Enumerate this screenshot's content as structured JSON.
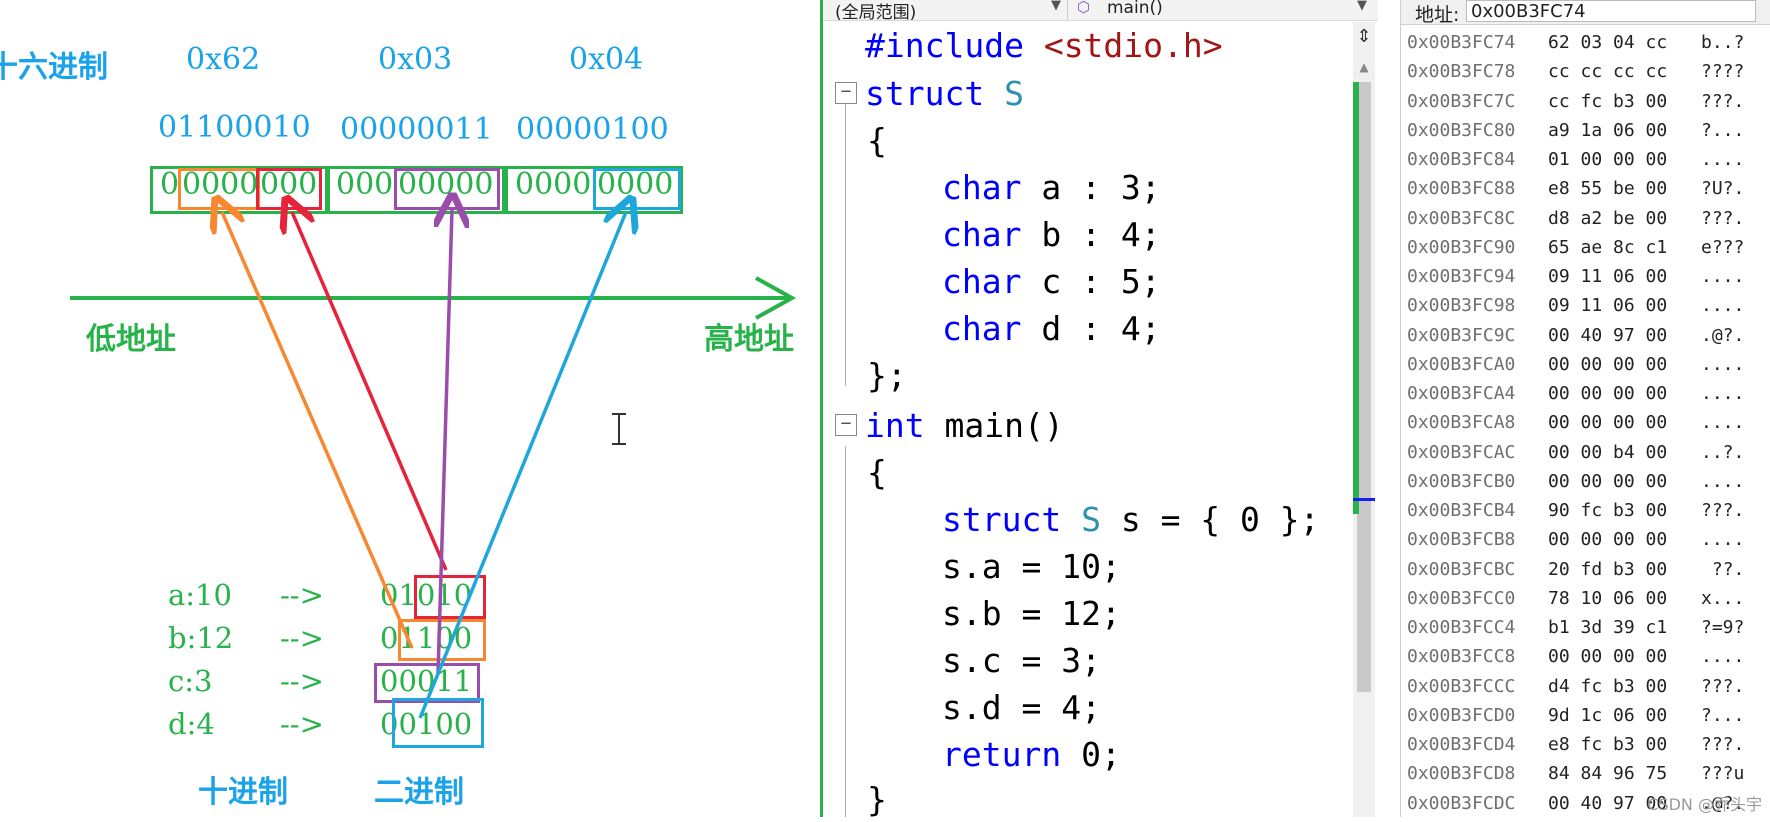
{
  "diagram": {
    "hex_label": "十六进制",
    "hex_values": [
      "0x62",
      "0x03",
      "0x04"
    ],
    "binary_values": [
      "01100010",
      "00000011",
      "00000100"
    ],
    "bytes": [
      {
        "prefix": "0",
        "mid": "0000",
        "tail": "000"
      },
      {
        "prefix": "000",
        "mid": "00000",
        "tail": ""
      },
      {
        "prefix": "0000",
        "mid": "0000",
        "tail": ""
      }
    ],
    "low_address": "低地址",
    "high_address": "高地址",
    "assignments": [
      {
        "name": "a:10",
        "arrow": "-->",
        "bits": "01010"
      },
      {
        "name": "b:12",
        "arrow": "-->",
        "bits": "01100"
      },
      {
        "name": "c:3",
        "arrow": "-->",
        "bits": "00011"
      },
      {
        "name": "d:4",
        "arrow": "-->",
        "bits": "00100"
      }
    ],
    "decimal_label": "十进制",
    "binary_label": "二进制",
    "colors": {
      "green": "#27b24a",
      "blue": "#1aa3e8",
      "orange": "#f7882f",
      "red": "#e5233b",
      "purple": "#9b4dab",
      "cyan": "#1ea7dc"
    }
  },
  "editor": {
    "scope_dropdown": "(全局范围)",
    "function_dropdown": "main()",
    "lines": {
      "l1_kw": "#include",
      "l1_str": " <stdio.h>",
      "l2_kw": "struct",
      "l2_tp": " S",
      "l3": "{",
      "l4_kw": "char",
      "l4_rest": " a : 3;",
      "l5_kw": "char",
      "l5_rest": " b : 4;",
      "l6_kw": "char",
      "l6_rest": " c : 5;",
      "l7_kw": "char",
      "l7_rest": " d : 4;",
      "l8": "};",
      "l9_kw": "int",
      "l9_rest": " main()",
      "l10": "{",
      "l11_kw": "struct",
      "l11_tp": " S",
      "l11_rest": " s = { 0 };",
      "l12": "s.a = 10;",
      "l13": "s.b = 12;",
      "l14": "s.c = 3;",
      "l15": "s.d = 4;",
      "l16_kw": "return",
      "l16_rest": " 0;",
      "l17": "}"
    }
  },
  "memory": {
    "address_label": "地址:",
    "address_value": "0x00B3FC74",
    "rows": [
      {
        "addr": "0x00B3FC74",
        "bytes": "62 03 04 cc",
        "ascii": "b..?"
      },
      {
        "addr": "0x00B3FC78",
        "bytes": "cc cc cc cc",
        "ascii": "????"
      },
      {
        "addr": "0x00B3FC7C",
        "bytes": "cc fc b3 00",
        "ascii": "???."
      },
      {
        "addr": "0x00B3FC80",
        "bytes": "a9 1a 06 00",
        "ascii": "?..."
      },
      {
        "addr": "0x00B3FC84",
        "bytes": "01 00 00 00",
        "ascii": "...."
      },
      {
        "addr": "0x00B3FC88",
        "bytes": "e8 55 be 00",
        "ascii": "?U?."
      },
      {
        "addr": "0x00B3FC8C",
        "bytes": "d8 a2 be 00",
        "ascii": "???."
      },
      {
        "addr": "0x00B3FC90",
        "bytes": "65 ae 8c c1",
        "ascii": "e???"
      },
      {
        "addr": "0x00B3FC94",
        "bytes": "09 11 06 00",
        "ascii": "...."
      },
      {
        "addr": "0x00B3FC98",
        "bytes": "09 11 06 00",
        "ascii": "...."
      },
      {
        "addr": "0x00B3FC9C",
        "bytes": "00 40 97 00",
        "ascii": ".@?."
      },
      {
        "addr": "0x00B3FCA0",
        "bytes": "00 00 00 00",
        "ascii": "...."
      },
      {
        "addr": "0x00B3FCA4",
        "bytes": "00 00 00 00",
        "ascii": "...."
      },
      {
        "addr": "0x00B3FCA8",
        "bytes": "00 00 00 00",
        "ascii": "...."
      },
      {
        "addr": "0x00B3FCAC",
        "bytes": "00 00 b4 00",
        "ascii": "..?."
      },
      {
        "addr": "0x00B3FCB0",
        "bytes": "00 00 00 00",
        "ascii": "...."
      },
      {
        "addr": "0x00B3FCB4",
        "bytes": "90 fc b3 00",
        "ascii": "???."
      },
      {
        "addr": "0x00B3FCB8",
        "bytes": "00 00 00 00",
        "ascii": "...."
      },
      {
        "addr": "0x00B3FCBC",
        "bytes": "20 fd b3 00",
        "ascii": " ??."
      },
      {
        "addr": "0x00B3FCC0",
        "bytes": "78 10 06 00",
        "ascii": "x..."
      },
      {
        "addr": "0x00B3FCC4",
        "bytes": "b1 3d 39 c1",
        "ascii": "?=9?"
      },
      {
        "addr": "0x00B3FCC8",
        "bytes": "00 00 00 00",
        "ascii": "...."
      },
      {
        "addr": "0x00B3FCCC",
        "bytes": "d4 fc b3 00",
        "ascii": "???."
      },
      {
        "addr": "0x00B3FCD0",
        "bytes": "9d 1c 06 00",
        "ascii": "?..."
      },
      {
        "addr": "0x00B3FCD4",
        "bytes": "e8 fc b3 00",
        "ascii": "???."
      },
      {
        "addr": "0x00B3FCD8",
        "bytes": "84 84 96 75",
        "ascii": "???u"
      },
      {
        "addr": "0x00B3FCDC",
        "bytes": "00 40 97 00",
        "ascii": ".@?."
      }
    ]
  },
  "watermark": "CSDN @乔头宇"
}
